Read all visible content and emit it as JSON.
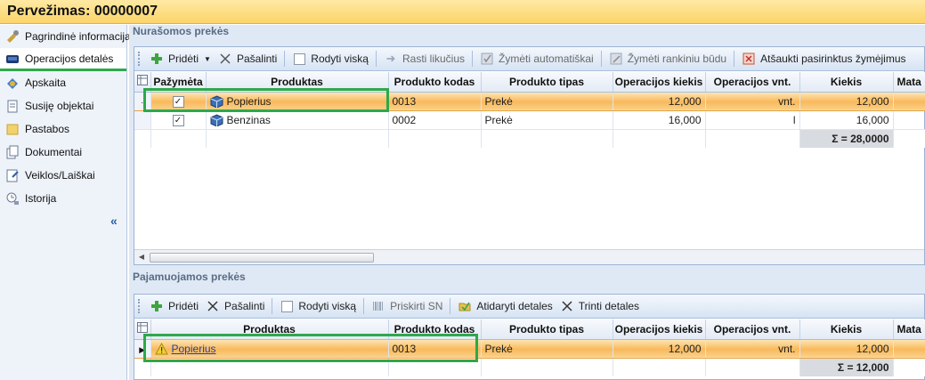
{
  "window": {
    "title": "Pervežimas: 00000007"
  },
  "sidebar": {
    "items": [
      {
        "label": "Pagrindinė informacija",
        "icon": "info-icon"
      },
      {
        "label": "Operacijos detalės",
        "icon": "truck-icon",
        "active": true
      },
      {
        "label": "Apskaita",
        "icon": "accounting-icon"
      },
      {
        "label": "Susiję objektai",
        "icon": "document-icon"
      },
      {
        "label": "Pastabos",
        "icon": "note-icon"
      },
      {
        "label": "Dokumentai",
        "icon": "pages-icon"
      },
      {
        "label": "Veiklos/Laiškai",
        "icon": "mail-icon"
      },
      {
        "label": "Istorija",
        "icon": "history-icon"
      }
    ],
    "collapse_label": "«"
  },
  "written_off": {
    "section_title": "Nurašomos prekės",
    "toolbar": {
      "add": "Pridėti",
      "remove": "Pašalinti",
      "show_all": "Rodyti viską",
      "find_balances": "Rasti likučius",
      "mark_auto": "Žymėti automatiškai",
      "mark_manual": "Žymėti rankiniu būdu",
      "cancel_marks": "Atšaukti pasirinktus žymėjimus"
    },
    "columns": [
      "Pažymėta",
      "Produktas",
      "Produkto kodas",
      "Produkto tipas",
      "Operacijos kiekis",
      "Operacijos vnt.",
      "Kiekis",
      "Mata"
    ],
    "rows": [
      {
        "marked": true,
        "product": "Popierius",
        "code": "0013",
        "type": "Prekė",
        "op_qty": "12,000",
        "op_unit": "vnt.",
        "qty": "12,000",
        "selected": true
      },
      {
        "marked": true,
        "product": "Benzinas",
        "code": "0002",
        "type": "Prekė",
        "op_qty": "16,000",
        "op_unit": "l",
        "qty": "16,000",
        "selected": false
      }
    ],
    "total": "Σ = 28,0000"
  },
  "incoming": {
    "section_title": "Pajamuojamos prekės",
    "toolbar": {
      "add": "Pridėti",
      "remove": "Pašalinti",
      "show_all": "Rodyti viską",
      "assign_sn": "Priskirti SN",
      "open_details": "Atidaryti detales",
      "delete_details": "Trinti detales"
    },
    "columns": [
      "Produktas",
      "Produkto kodas",
      "Produkto tipas",
      "Operacijos kiekis",
      "Operacijos vnt.",
      "Kiekis",
      "Mata"
    ],
    "rows": [
      {
        "product": "Popierius",
        "code": "0013",
        "type": "Prekė",
        "op_qty": "12,000",
        "op_unit": "vnt.",
        "qty": "12,000",
        "selected": true
      }
    ],
    "total": "Σ = 12,000"
  },
  "colors": {
    "highlight": "#2ea84a",
    "selection": "#f9b95c",
    "accent": "#1f3fb3"
  }
}
